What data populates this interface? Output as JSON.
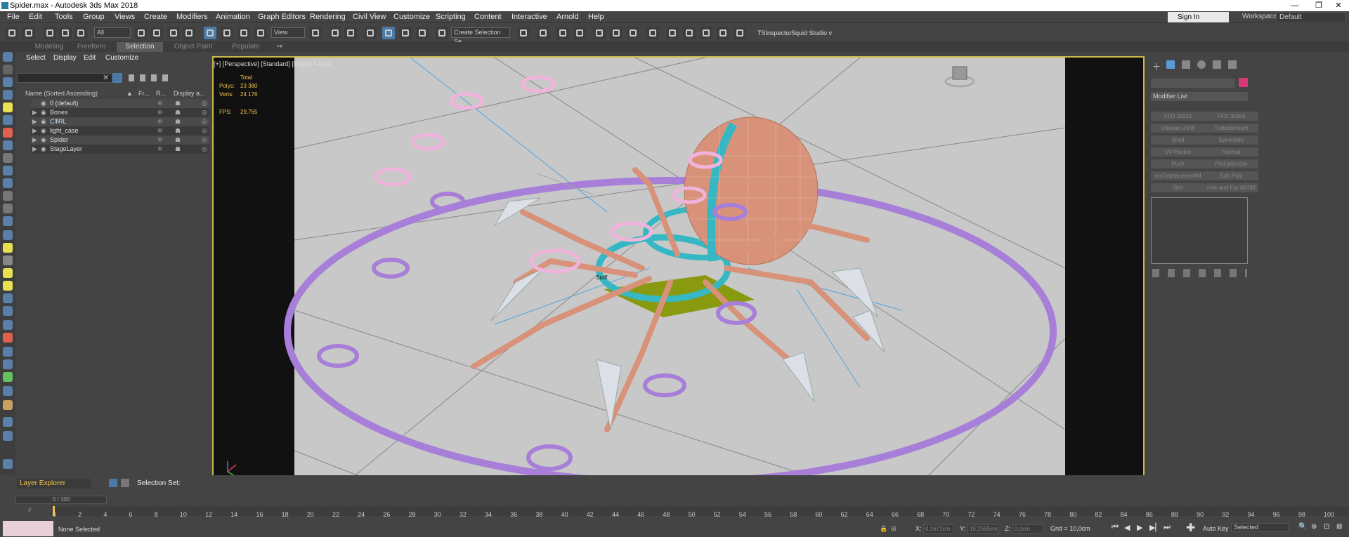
{
  "window": {
    "title": "Spider.max - Autodesk 3ds Max 2018",
    "controls": [
      "—",
      "❐",
      "✕"
    ]
  },
  "menu": [
    "File",
    "Edit",
    "Tools",
    "Group",
    "Views",
    "Create",
    "Modifiers",
    "Animation",
    "Graph Editors",
    "Rendering",
    "Civil View",
    "Customize",
    "Scripting",
    "Content",
    "Interactive",
    "Arnold",
    "Help"
  ],
  "account": {
    "signin": "Sign In",
    "workspaces_label": "Workspaces:",
    "workspace": "Default"
  },
  "toolbar": {
    "filter": "All",
    "ref_coord": "View",
    "selection_set": "Create Selection Se",
    "tsinspector": "TSInspector",
    "squid": "Squid Studio v"
  },
  "ribbon_tabs": [
    "Modeling",
    "Freeform",
    "Selection",
    "Object Paint",
    "Populate"
  ],
  "ribbon_active": "Selection",
  "scene_tabs": [
    "Select",
    "Display",
    "Edit",
    "Customize"
  ],
  "scene_columns": [
    "Name (Sorted Ascending)",
    "Fr...",
    "R...",
    "Display a..."
  ],
  "scene_items": [
    {
      "name": "0 (default)",
      "expand": ""
    },
    {
      "name": "Bones",
      "expand": "▶"
    },
    {
      "name": "CTRL",
      "expand": "▶"
    },
    {
      "name": "light_case",
      "expand": "▶"
    },
    {
      "name": "Spider",
      "expand": "▶"
    },
    {
      "name": "StageLayer",
      "expand": "▶"
    }
  ],
  "viewport": {
    "label": "[+] [Perspective] [Standard]",
    "shading": "[Edged Faces]",
    "total": "Total",
    "polys_label": "Polys:",
    "polys": "23 380",
    "verts_label": "Verts:",
    "verts": "24 176",
    "fps_label": "FPS:",
    "fps": "29,765",
    "center_label": "Staff"
  },
  "command_panel": {
    "modifier_list": "Modifier List",
    "modifiers": [
      "FFD 2x2x2",
      "FFD 3x3x3",
      "Unwrap UVW",
      "TurboSmooth",
      "Shell",
      "Symmetry",
      "UV-Packer",
      "Normal",
      "Push",
      "ProOptimizer",
      "rayDisplacementM",
      "Edit Poly",
      "Skin",
      "Hair and Fur (WSM"
    ]
  },
  "layer_explorer": {
    "label": "Layer Explorer",
    "selection_set": "Selection Set:"
  },
  "timeline": {
    "frame": "0 / 100",
    "ticks": [
      "0",
      "2",
      "4",
      "6",
      "8",
      "10",
      "12",
      "14",
      "16",
      "18",
      "20",
      "22",
      "24",
      "26",
      "28",
      "30",
      "32",
      "34",
      "36",
      "38",
      "40",
      "42",
      "44",
      "46",
      "48",
      "50",
      "52",
      "54",
      "56",
      "58",
      "60",
      "62",
      "64",
      "66",
      "68",
      "70",
      "72",
      "74",
      "76",
      "78",
      "80",
      "82",
      "84",
      "86",
      "88",
      "90",
      "92",
      "94",
      "96",
      "98",
      "100"
    ]
  },
  "status": {
    "selection": "None Selected",
    "x_label": "X:",
    "x": "0,1671cm",
    "y_label": "Y:",
    "y": "15,2565cm",
    "z_label": "Z:",
    "z": "0,0cm",
    "grid": "Grid = 10,0cm",
    "autokey": "Auto Key",
    "key_mode": "Selected"
  },
  "colors": {
    "accent": "#4b79a8",
    "viewport_border": "#c8b84e",
    "ring_purple": "#a77ed8",
    "ring_pink": "#f0b4dc",
    "body": "#d9927a",
    "teal": "#35b8c4"
  }
}
